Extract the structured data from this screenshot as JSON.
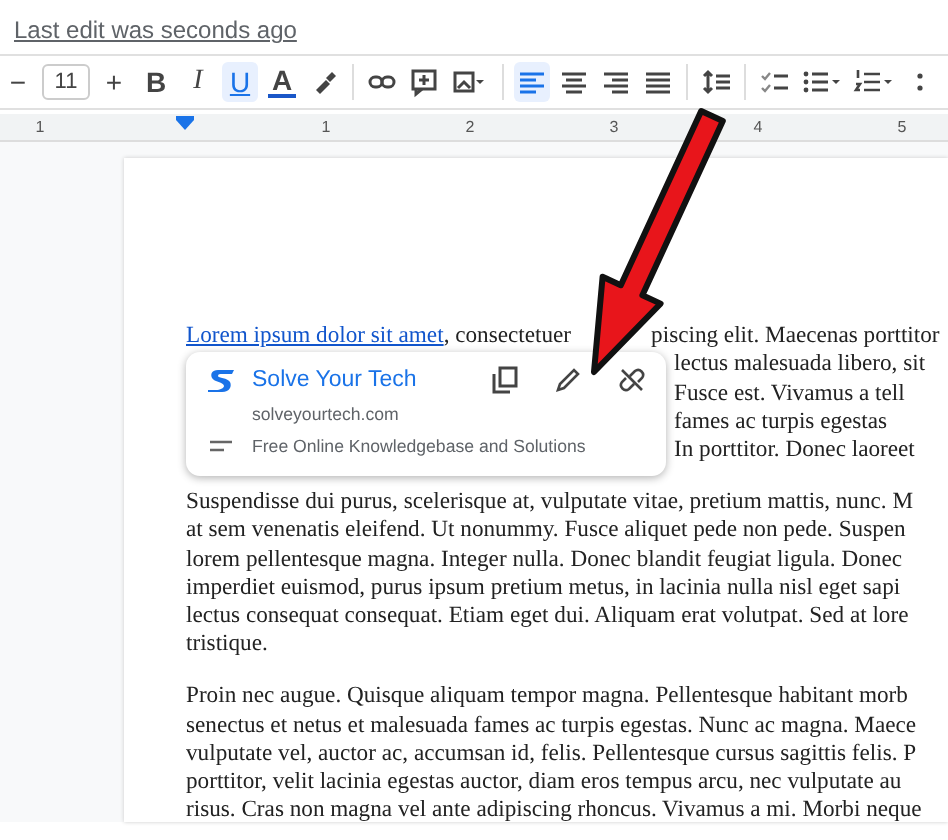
{
  "header": {
    "last_edit": "Last edit was seconds ago"
  },
  "toolbar": {
    "font_size": {
      "decrease": "−",
      "value": "11",
      "increase": "+"
    },
    "buttons": [
      {
        "kind": "bold",
        "label": "B",
        "selected": false
      },
      {
        "kind": "italic",
        "label": "I",
        "selected": false
      },
      {
        "kind": "underline",
        "label": "U",
        "selected": true
      },
      {
        "kind": "text-color",
        "label": "A"
      },
      {
        "kind": "highlight"
      },
      {
        "kind": "sep"
      },
      {
        "kind": "link"
      },
      {
        "kind": "comment"
      },
      {
        "kind": "image"
      },
      {
        "kind": "sep"
      },
      {
        "kind": "align-left",
        "selected": true
      },
      {
        "kind": "align-center",
        "selected": false
      },
      {
        "kind": "align-right",
        "selected": false
      },
      {
        "kind": "justify",
        "selected": false
      },
      {
        "kind": "sep"
      },
      {
        "kind": "line-spacing"
      },
      {
        "kind": "sep"
      },
      {
        "kind": "checklist"
      },
      {
        "kind": "bullets"
      },
      {
        "kind": "numbered"
      }
    ]
  },
  "ruler": {
    "labels": [
      "1",
      "1",
      "2",
      "3",
      "4",
      "5"
    ]
  },
  "document": {
    "first_line": {
      "link": "Lorem ipsum dolor sit amet",
      "after_link": ", consectetuer",
      "after_arrow": "piscing elit. Maecenas porttitor"
    },
    "beside_card": [
      "lectus malesuada libero, sit",
      "Fusce est. Vivamus a tell",
      "fames ac turpis egestas",
      "In porttitor. Donec laoreet"
    ],
    "paragraphs": [
      [
        "Suspendisse dui purus, scelerisque at, vulputate vitae, pretium mattis, nunc. M",
        "at sem venenatis eleifend. Ut nonummy. Fusce aliquet pede non pede. Suspen",
        "lorem pellentesque magna. Integer nulla. Donec blandit feugiat ligula. Donec",
        "imperdiet euismod, purus ipsum pretium metus, in lacinia nulla nisl eget sapi",
        "lectus consequat consequat. Etiam eget dui. Aliquam erat volutpat. Sed at lore",
        "tristique."
      ],
      [
        "Proin nec augue. Quisque aliquam tempor magna. Pellentesque habitant morb",
        "senectus et netus et malesuada fames ac turpis egestas. Nunc ac magna. Maece",
        "vulputate vel, auctor ac, accumsan id, felis. Pellentesque cursus sagittis felis. P",
        "porttitor, velit lacinia egestas auctor, diam eros tempus arcu, nec vulputate au",
        "risus. Cras non magna vel ante adipiscing rhoncus. Vivamus a mi. Morbi neque"
      ]
    ]
  },
  "link_card": {
    "title": "Solve Your Tech",
    "domain": "solveyourtech.com",
    "description": "Free Online Knowledgebase and Solutions"
  }
}
